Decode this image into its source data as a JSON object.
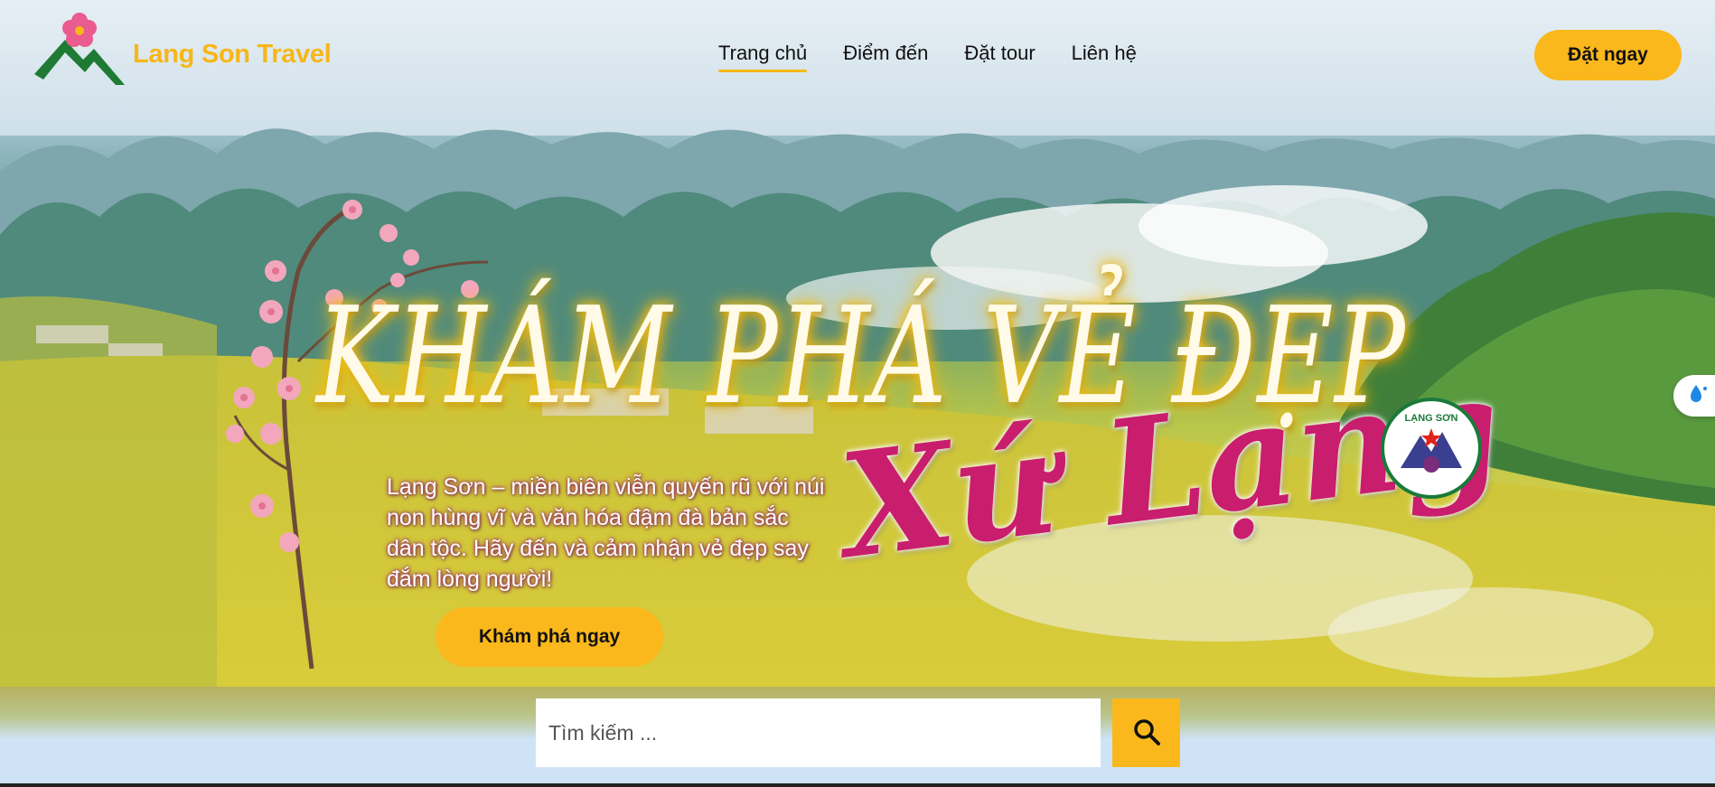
{
  "header": {
    "brand": "Lang Son Travel",
    "nav": [
      {
        "label": "Trang chủ",
        "active": true
      },
      {
        "label": "Điểm đến",
        "active": false
      },
      {
        "label": "Đặt tour",
        "active": false
      },
      {
        "label": "Liên hệ",
        "active": false
      }
    ],
    "book_button": "Đặt ngay"
  },
  "hero": {
    "title": "KHÁM PHÁ VẺ ĐẸP",
    "script_title": "Xứ Lạng",
    "badge_text": "LẠNG SƠN",
    "intro": "Lạng Sơn – miền biên viễn quyến rũ với núi non hùng vĩ và văn hóa đậm đà bản sắc dân tộc. Hãy đến và cảm nhận vẻ đẹp say đắm lòng người!",
    "explore_button": "Khám phá ngay"
  },
  "search": {
    "placeholder": "Tìm kiếm ..."
  },
  "colors": {
    "accent": "#fbb81c",
    "brand_text": "#f7b718",
    "script_pink": "#c91d6e"
  },
  "icons": {
    "logo": "mountain-blossom-logo",
    "search": "search-icon",
    "side_tab": "water-drop-icon"
  }
}
